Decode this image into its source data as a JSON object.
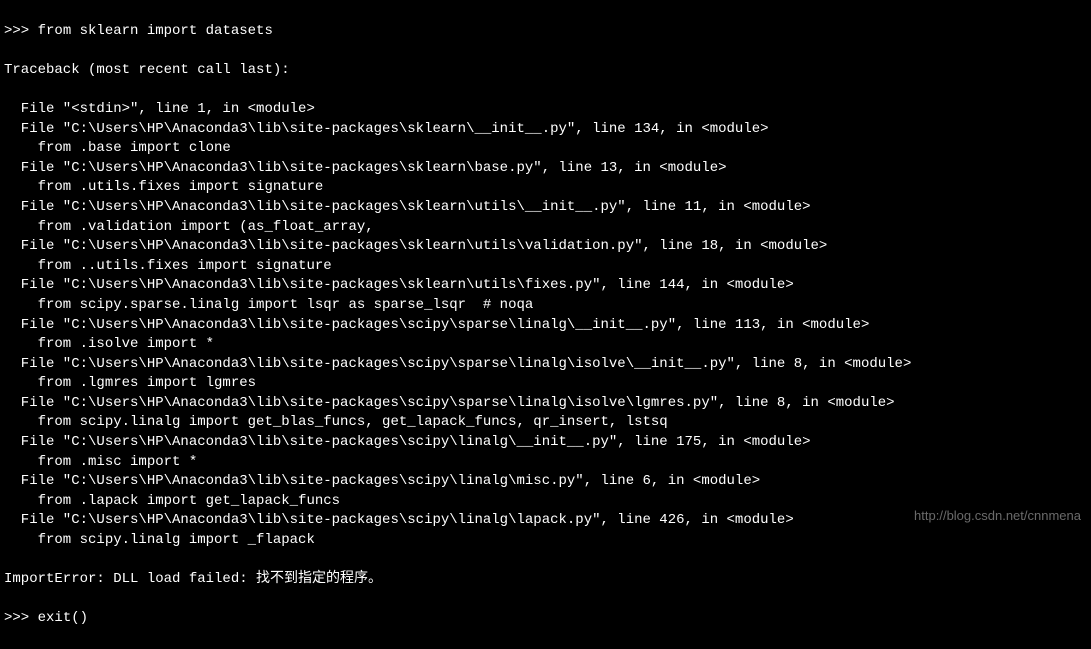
{
  "terminal": {
    "prompt": ">>> ",
    "command": "from sklearn import datasets",
    "traceback_header": "Traceback (most recent call last):",
    "frames": [
      {
        "file": "  File \"<stdin>\", line 1, in <module>",
        "src": ""
      },
      {
        "file": "  File \"C:\\Users\\HP\\Anaconda3\\lib\\site-packages\\sklearn\\__init__.py\", line 134, in <module>",
        "src": "    from .base import clone"
      },
      {
        "file": "  File \"C:\\Users\\HP\\Anaconda3\\lib\\site-packages\\sklearn\\base.py\", line 13, in <module>",
        "src": "    from .utils.fixes import signature"
      },
      {
        "file": "  File \"C:\\Users\\HP\\Anaconda3\\lib\\site-packages\\sklearn\\utils\\__init__.py\", line 11, in <module>",
        "src": "    from .validation import (as_float_array,"
      },
      {
        "file": "  File \"C:\\Users\\HP\\Anaconda3\\lib\\site-packages\\sklearn\\utils\\validation.py\", line 18, in <module>",
        "src": "    from ..utils.fixes import signature"
      },
      {
        "file": "  File \"C:\\Users\\HP\\Anaconda3\\lib\\site-packages\\sklearn\\utils\\fixes.py\", line 144, in <module>",
        "src": "    from scipy.sparse.linalg import lsqr as sparse_lsqr  # noqa"
      },
      {
        "file": "  File \"C:\\Users\\HP\\Anaconda3\\lib\\site-packages\\scipy\\sparse\\linalg\\__init__.py\", line 113, in <module>",
        "src": "    from .isolve import *"
      },
      {
        "file": "  File \"C:\\Users\\HP\\Anaconda3\\lib\\site-packages\\scipy\\sparse\\linalg\\isolve\\__init__.py\", line 8, in <module>",
        "src": "    from .lgmres import lgmres"
      },
      {
        "file": "  File \"C:\\Users\\HP\\Anaconda3\\lib\\site-packages\\scipy\\sparse\\linalg\\isolve\\lgmres.py\", line 8, in <module>",
        "src": "    from scipy.linalg import get_blas_funcs, get_lapack_funcs, qr_insert, lstsq"
      },
      {
        "file": "  File \"C:\\Users\\HP\\Anaconda3\\lib\\site-packages\\scipy\\linalg\\__init__.py\", line 175, in <module>",
        "src": "    from .misc import *"
      },
      {
        "file": "  File \"C:\\Users\\HP\\Anaconda3\\lib\\site-packages\\scipy\\linalg\\misc.py\", line 6, in <module>",
        "src": "    from .lapack import get_lapack_funcs"
      },
      {
        "file": "  File \"C:\\Users\\HP\\Anaconda3\\lib\\site-packages\\scipy\\linalg\\lapack.py\", line 426, in <module>",
        "src": "    from scipy.linalg import _flapack"
      }
    ],
    "error": "ImportError: DLL load failed: 找不到指定的程序。",
    "next_prompt": ">>> ",
    "next_command": "exit()"
  },
  "watermark": "http://blog.csdn.net/cnnmena"
}
